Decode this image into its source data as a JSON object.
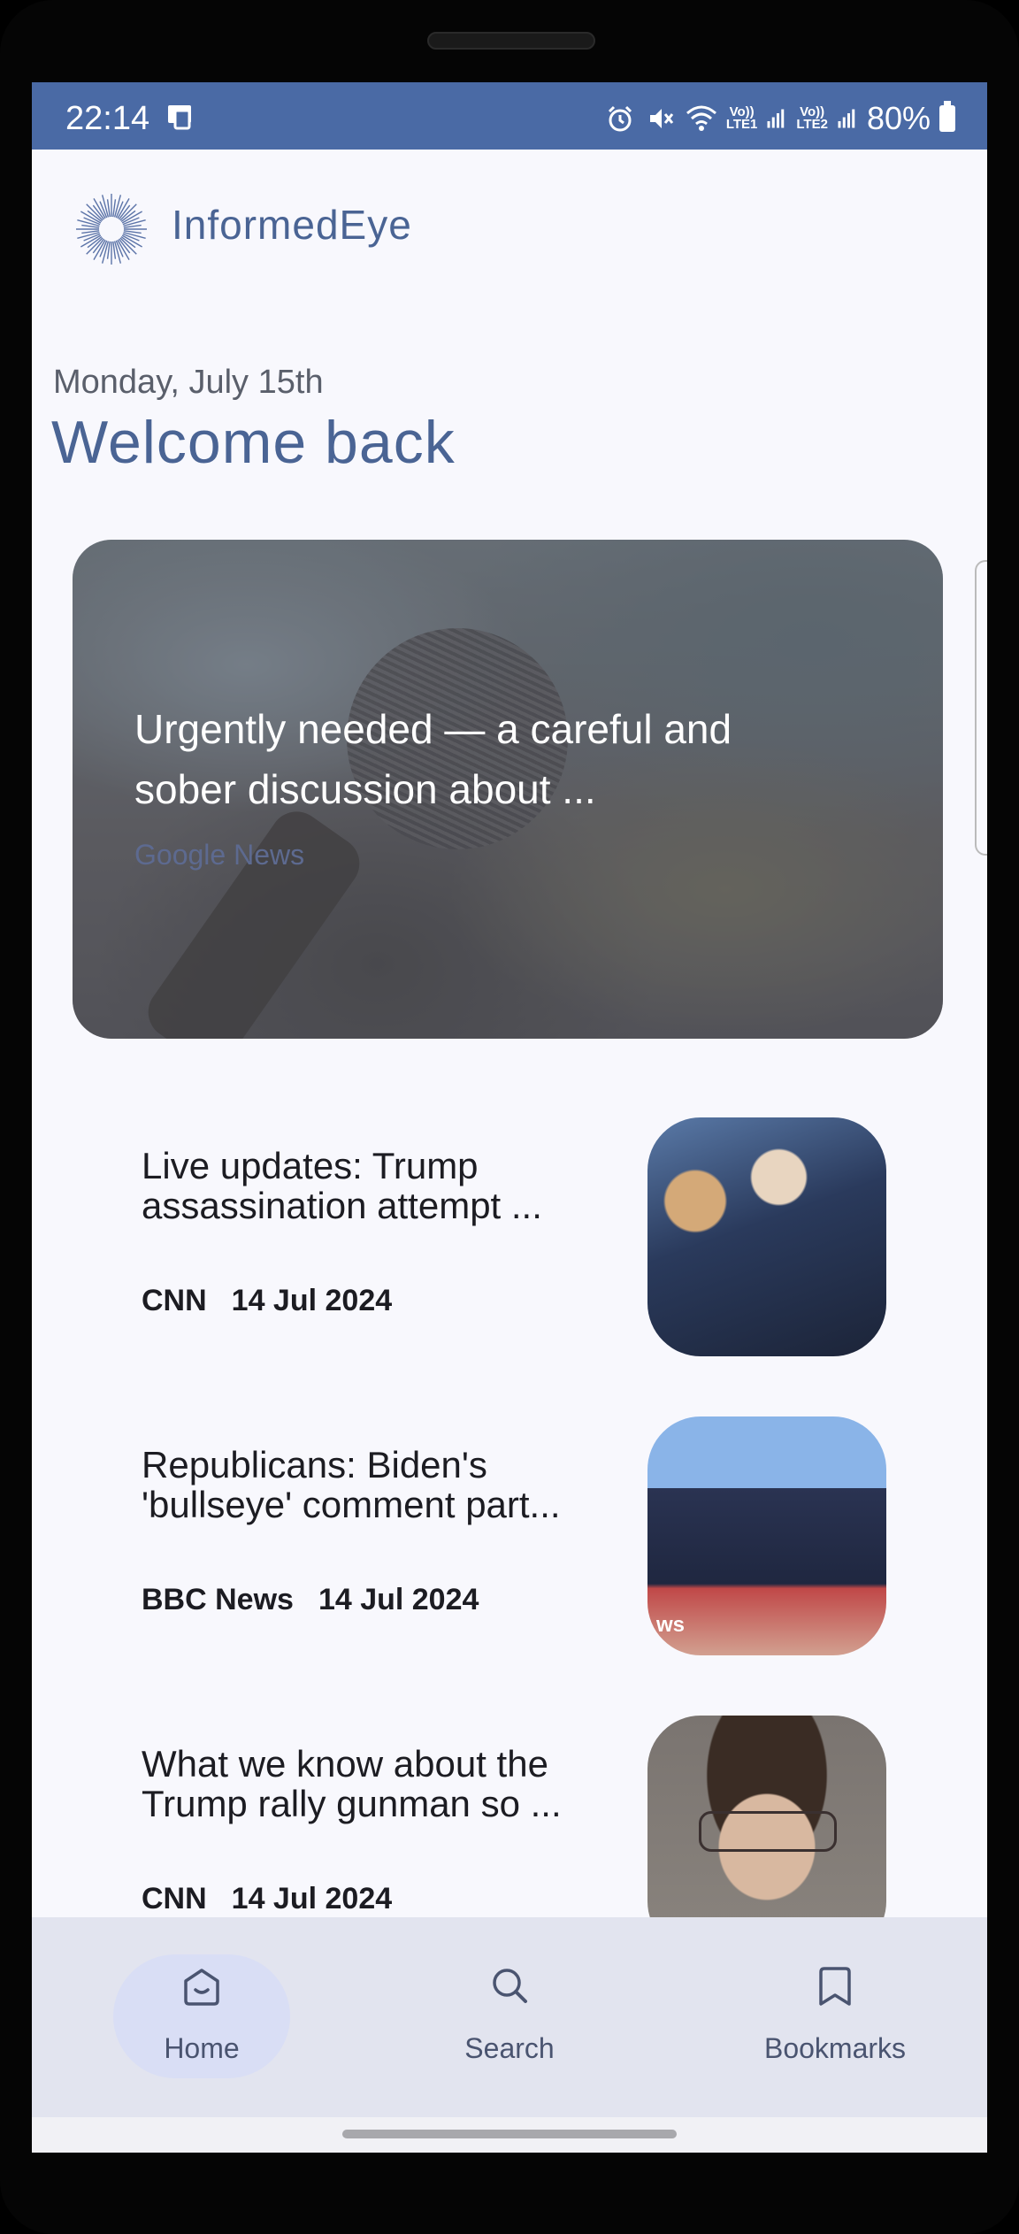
{
  "status_bar": {
    "time": "22:14",
    "icons": [
      "cast-icon",
      "alarm-icon",
      "mute-icon",
      "wifi-icon",
      "signal-icon",
      "signal-icon",
      "battery-icon"
    ],
    "volte1": "Vo))\nLTE1",
    "volte2": "Vo))\nLTE2",
    "battery": "80%"
  },
  "app": {
    "name": "InformedEye",
    "logo": "sunburst-logo",
    "accent_color": "#4a6494",
    "status_bar_color": "#4a6aa5"
  },
  "header": {
    "date": "Monday, July 15th",
    "greeting": "Welcome back"
  },
  "featured": {
    "title": "Urgently needed — a careful and sober discussion about ...",
    "source": "Google News",
    "image": "microphone-photo"
  },
  "articles": [
    {
      "title": "Live updates: Trump assassination attempt ...",
      "source": "CNN",
      "date": "14 Jul 2024",
      "image": "rally-photo"
    },
    {
      "title": "Republicans: Biden's 'bullseye' comment part...",
      "source": "BBC News",
      "date": "14 Jul 2024",
      "image": "rally-stage-photo",
      "image_caption": "ws"
    },
    {
      "title": "What we know about the Trump rally gunman so ...",
      "source": "CNN",
      "date": "14 Jul 2024",
      "image": "portrait-photo"
    }
  ],
  "bottom_nav": {
    "items": [
      {
        "label": "Home",
        "icon": "home-icon",
        "active": true
      },
      {
        "label": "Search",
        "icon": "search-icon",
        "active": false
      },
      {
        "label": "Bookmarks",
        "icon": "bookmark-icon",
        "active": false
      }
    ]
  }
}
